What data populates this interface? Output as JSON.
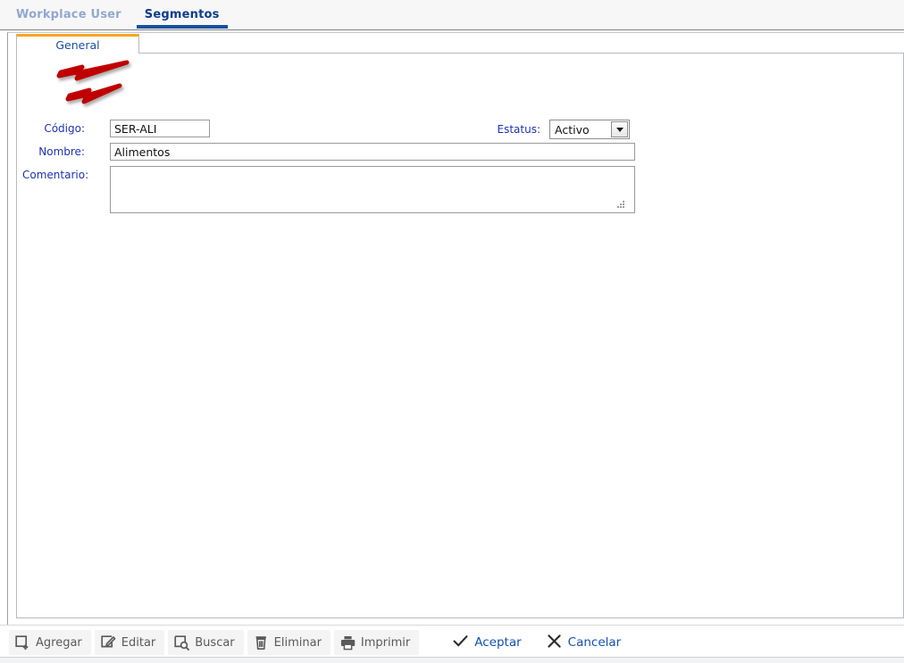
{
  "app": {
    "top_tabs": [
      {
        "label": "Workplace User",
        "active": false
      },
      {
        "label": "Segmentos",
        "active": true
      }
    ]
  },
  "inner_tab": {
    "label": "General",
    "accent_color": "#f5a623"
  },
  "form": {
    "fields": {
      "codigo": {
        "label": "Código:",
        "value": "SER-ALI",
        "placeholder": ""
      },
      "nombre": {
        "label": "Nombre:",
        "value": "Alimentos",
        "placeholder": ""
      },
      "comentario": {
        "label": "Comentario:",
        "value": "",
        "placeholder": ""
      },
      "estatus": {
        "label": "Estatus:",
        "value": "Activo",
        "options": [
          "Activo"
        ],
        "caret_icon": "chevron-down-icon"
      }
    },
    "label_color": "#1d32b9"
  },
  "annotations": {
    "arrow_color": "#c00000",
    "arrows": [
      {
        "name": "arrow-to-codigo-label",
        "target": "Código:"
      },
      {
        "name": "arrow-to-nombre-label",
        "target": "Nombre:"
      }
    ]
  },
  "toolbar": {
    "actions": [
      {
        "label": "Agregar",
        "icon": "add-square-icon"
      },
      {
        "label": "Editar",
        "icon": "pencil-square-icon"
      },
      {
        "label": "Buscar",
        "icon": "search-square-icon"
      },
      {
        "label": "Eliminar",
        "icon": "trash-icon"
      },
      {
        "label": "Imprimir",
        "icon": "printer-icon"
      }
    ],
    "confirm": [
      {
        "label": "Aceptar",
        "icon": "check-icon"
      },
      {
        "label": "Cancelar",
        "icon": "close-icon"
      }
    ],
    "link_color": "#1250b0"
  }
}
